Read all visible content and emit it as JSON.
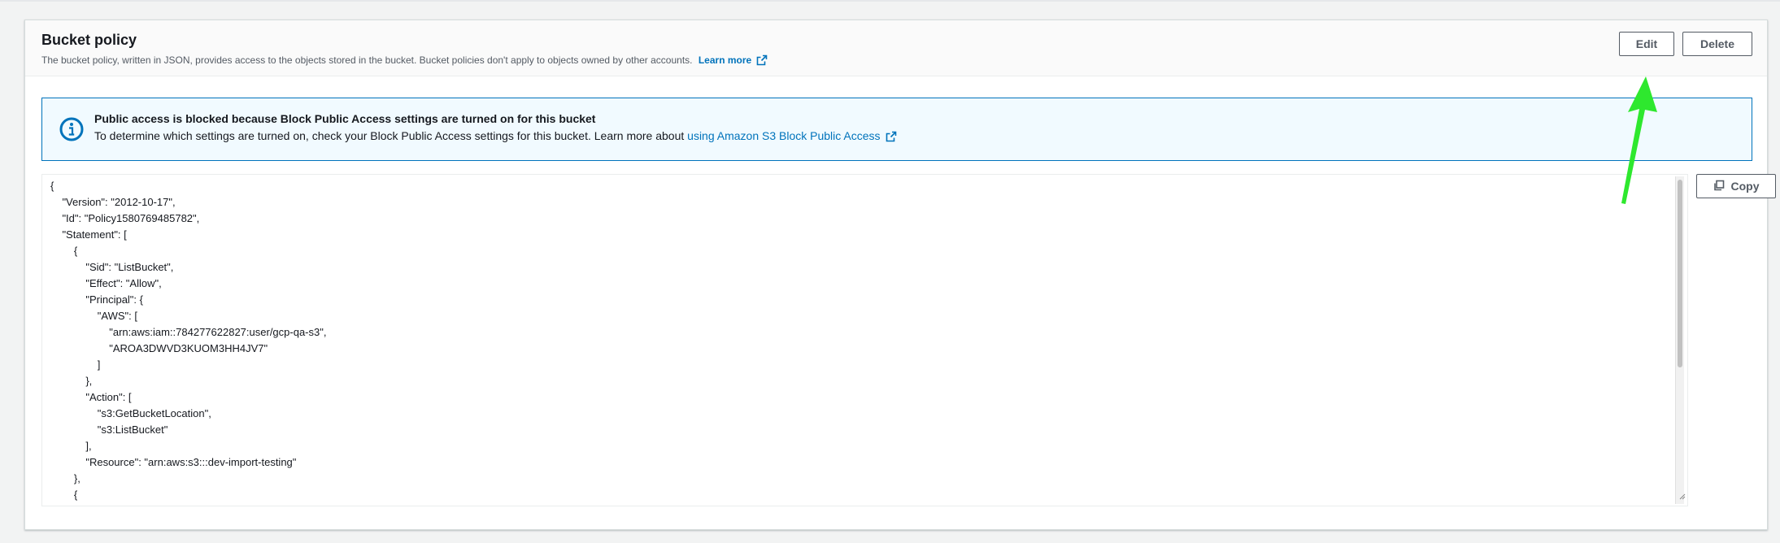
{
  "panel": {
    "title": "Bucket policy",
    "description": "The bucket policy, written in JSON, provides access to the objects stored in the bucket. Bucket policies don't apply to objects owned by other accounts.",
    "learn_more": "Learn more",
    "actions": {
      "edit": "Edit",
      "delete": "Delete"
    }
  },
  "alert": {
    "title": "Public access is blocked because Block Public Access settings are turned on for this bucket",
    "body": "To determine which settings are turned on, check your Block Public Access settings for this bucket. Learn more about",
    "link": "using Amazon S3 Block Public Access",
    "icon": "info-icon"
  },
  "policy": {
    "copy_label": "Copy",
    "json_text": "{\n    \"Version\": \"2012-10-17\",\n    \"Id\": \"Policy1580769485782\",\n    \"Statement\": [\n        {\n            \"Sid\": \"ListBucket\",\n            \"Effect\": \"Allow\",\n            \"Principal\": {\n                \"AWS\": [\n                    \"arn:aws:iam::784277622827:user/gcp-qa-s3\",\n                    \"AROA3DWVD3KUOM3HH4JV7\"\n                ]\n            },\n            \"Action\": [\n                \"s3:GetBucketLocation\",\n                \"s3:ListBucket\"\n            ],\n            \"Resource\": \"arn:aws:s3:::dev-import-testing\"\n        },\n        {"
  },
  "colors": {
    "link": "#0073bb",
    "alert_border": "#0073bb",
    "alert_background": "#f1faff",
    "annotation_arrow": "#2ee82e"
  }
}
